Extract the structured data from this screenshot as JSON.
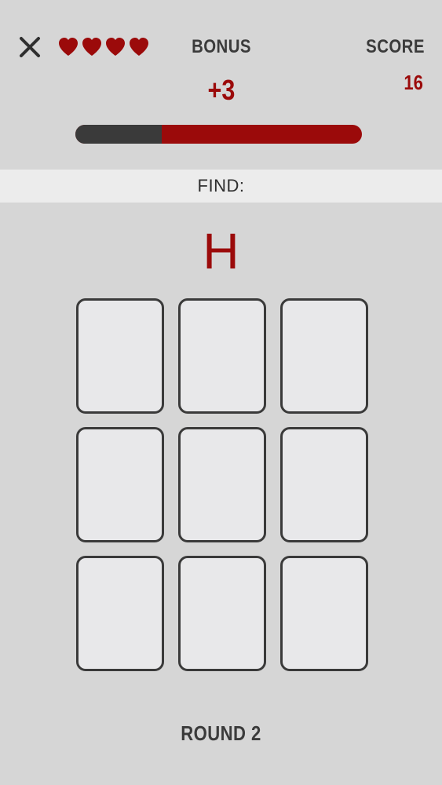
{
  "header": {
    "close_icon": "close-icon",
    "lives": 4,
    "heart_icon": "heart-icon",
    "bonus_label": "BONUS",
    "bonus_value": "+3",
    "score_label": "SCORE",
    "score_value": "16"
  },
  "timer": {
    "remaining_fraction": 0.7
  },
  "find": {
    "label": "FIND:",
    "target": "H"
  },
  "cards": {
    "count": 9,
    "rows": 3,
    "columns": 3
  },
  "footer": {
    "round_label": "ROUND 2"
  },
  "colors": {
    "background": "#d6d6d6",
    "accent_red": "#9b0a0a",
    "dark": "#3a3a3a",
    "card_fill": "#e8e8ea",
    "banner": "#ececec"
  }
}
